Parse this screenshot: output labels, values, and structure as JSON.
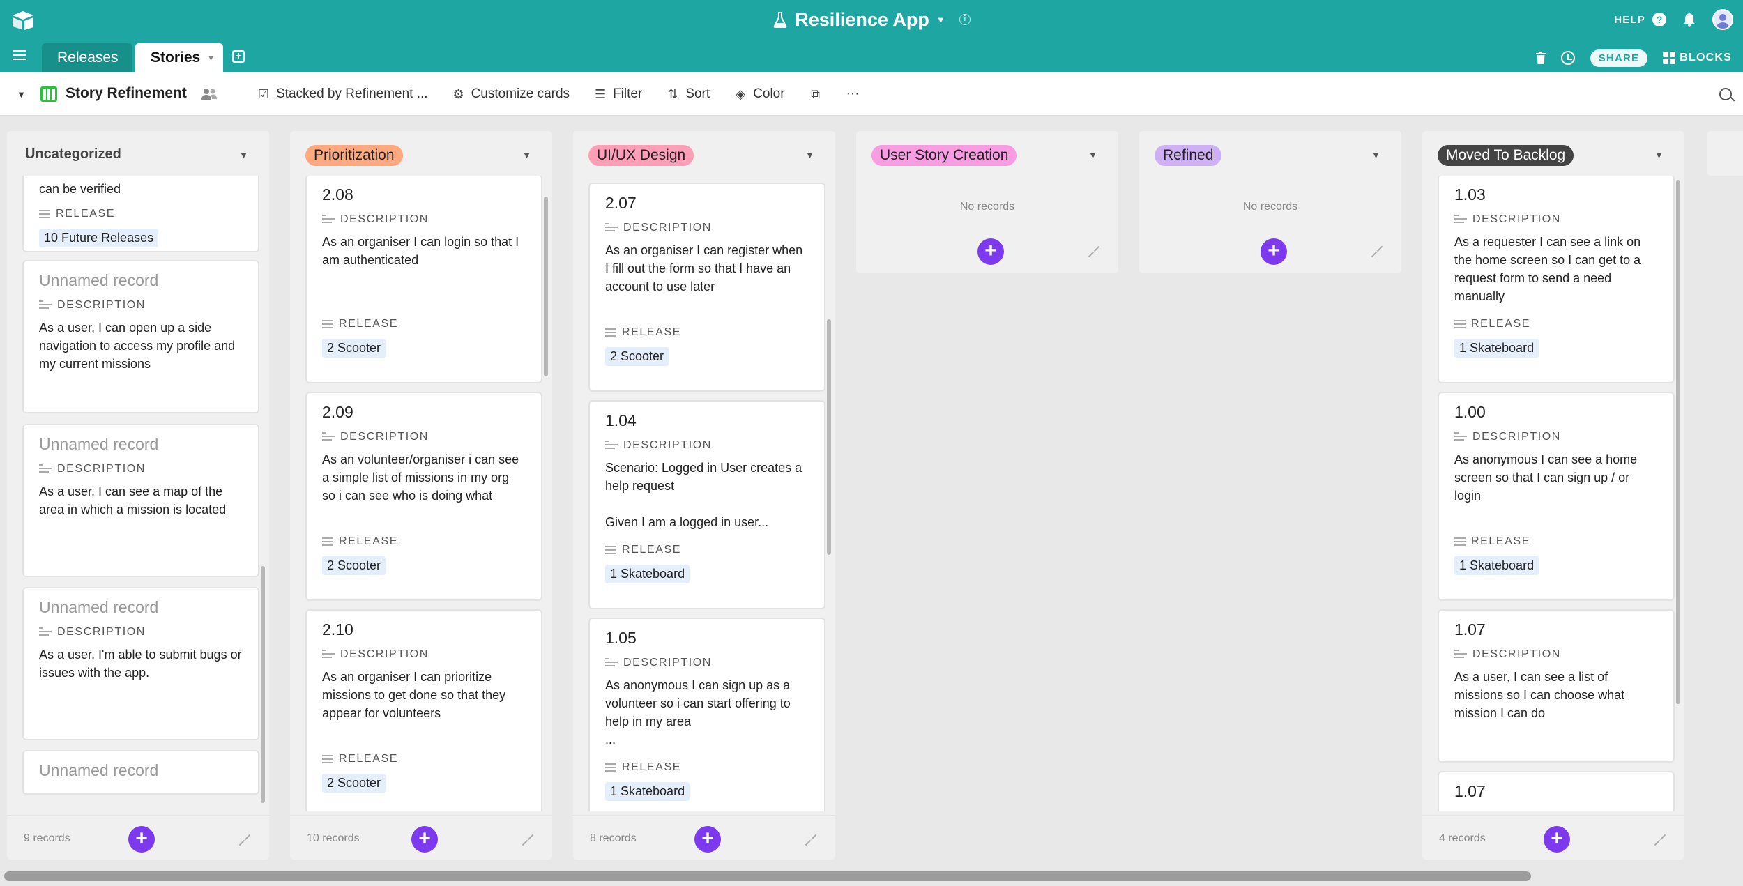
{
  "app": {
    "title": "Resilience App",
    "help_label": "HELP"
  },
  "tabs": {
    "releases": "Releases",
    "stories": "Stories"
  },
  "toolbar": {
    "share_label": "SHARE",
    "blocks_label": "BLOCKS"
  },
  "viewbar": {
    "view_name": "Story Refinement",
    "stacked_label": "Stacked by Refinement ...",
    "customize_label": "Customize cards",
    "filter_label": "Filter",
    "sort_label": "Sort",
    "color_label": "Color",
    "more_label": "···"
  },
  "labels": {
    "description": "DESCRIPTION",
    "release": "RELEASE",
    "no_records": "No records"
  },
  "colors": {
    "header_bg": "#1ea7a2",
    "add_button": "#7c39ed",
    "prioritization_pill": "#ffa981",
    "uiux_pill": "#ff9eb7",
    "user_story_pill": "#f99de2",
    "refined_pill": "#d0b0f5",
    "backlog_pill": "#444444"
  },
  "columns": [
    {
      "title": "Uncategorized",
      "count": "9 records",
      "top_fragment": {
        "text": "can be verified",
        "release": "10 Future Releases"
      },
      "cards": [
        {
          "title": "Unnamed record",
          "description": "As a user, I can open up a side navigation to access my profile and my current missions"
        },
        {
          "title": "Unnamed record",
          "description": "As a user, I can see a map of the area in which a mission is located"
        },
        {
          "title": "Unnamed record",
          "description": "As a user, I'm able to submit bugs or issues with the app."
        },
        {
          "title": "Unnamed record"
        }
      ]
    },
    {
      "title": "Prioritization",
      "count": "10 records",
      "cards": [
        {
          "title": "2.08",
          "description": "As an organiser I can login so that I am authenticated",
          "release": "2 Scooter"
        },
        {
          "title": "2.09",
          "description": "As an volunteer/organiser i can see a simple list of missions in my org so i can see who is doing what",
          "release": "2 Scooter"
        },
        {
          "title": "2.10",
          "description": "As an organiser I can prioritize missions to get done so that they appear for volunteers",
          "release": "2 Scooter"
        }
      ]
    },
    {
      "title": "UI/UX Design",
      "count": "8 records",
      "cards": [
        {
          "title": "2.07",
          "description": "As an organiser I can register when I fill out the form so that I have an account to use later",
          "release": "2 Scooter"
        },
        {
          "title": "1.04",
          "description": "Scenario: Logged in User creates a help request\n\nGiven I am a logged in user...",
          "release": "1 Skateboard"
        },
        {
          "title": "1.05",
          "description": "As anonymous I can sign up as a volunteer so i can start offering to help in my area\n...",
          "release": "1 Skateboard"
        }
      ]
    },
    {
      "title": "User Story Creation",
      "count": ""
    },
    {
      "title": "Refined",
      "count": ""
    },
    {
      "title": "Moved To Backlog",
      "count": "4 records",
      "cards": [
        {
          "title": "1.03",
          "description": "As a requester I can see a link on the home screen so I can get to a request form to send a need manually",
          "release": "1 Skateboard"
        },
        {
          "title": "1.00",
          "description": "As anonymous I can see a home screen so that I can sign up / or login",
          "release": "1 Skateboard"
        },
        {
          "title": "1.07",
          "description": "As a user, I can see a list of missions so I can choose what mission I can do"
        },
        {
          "title": "1.07"
        }
      ]
    }
  ]
}
